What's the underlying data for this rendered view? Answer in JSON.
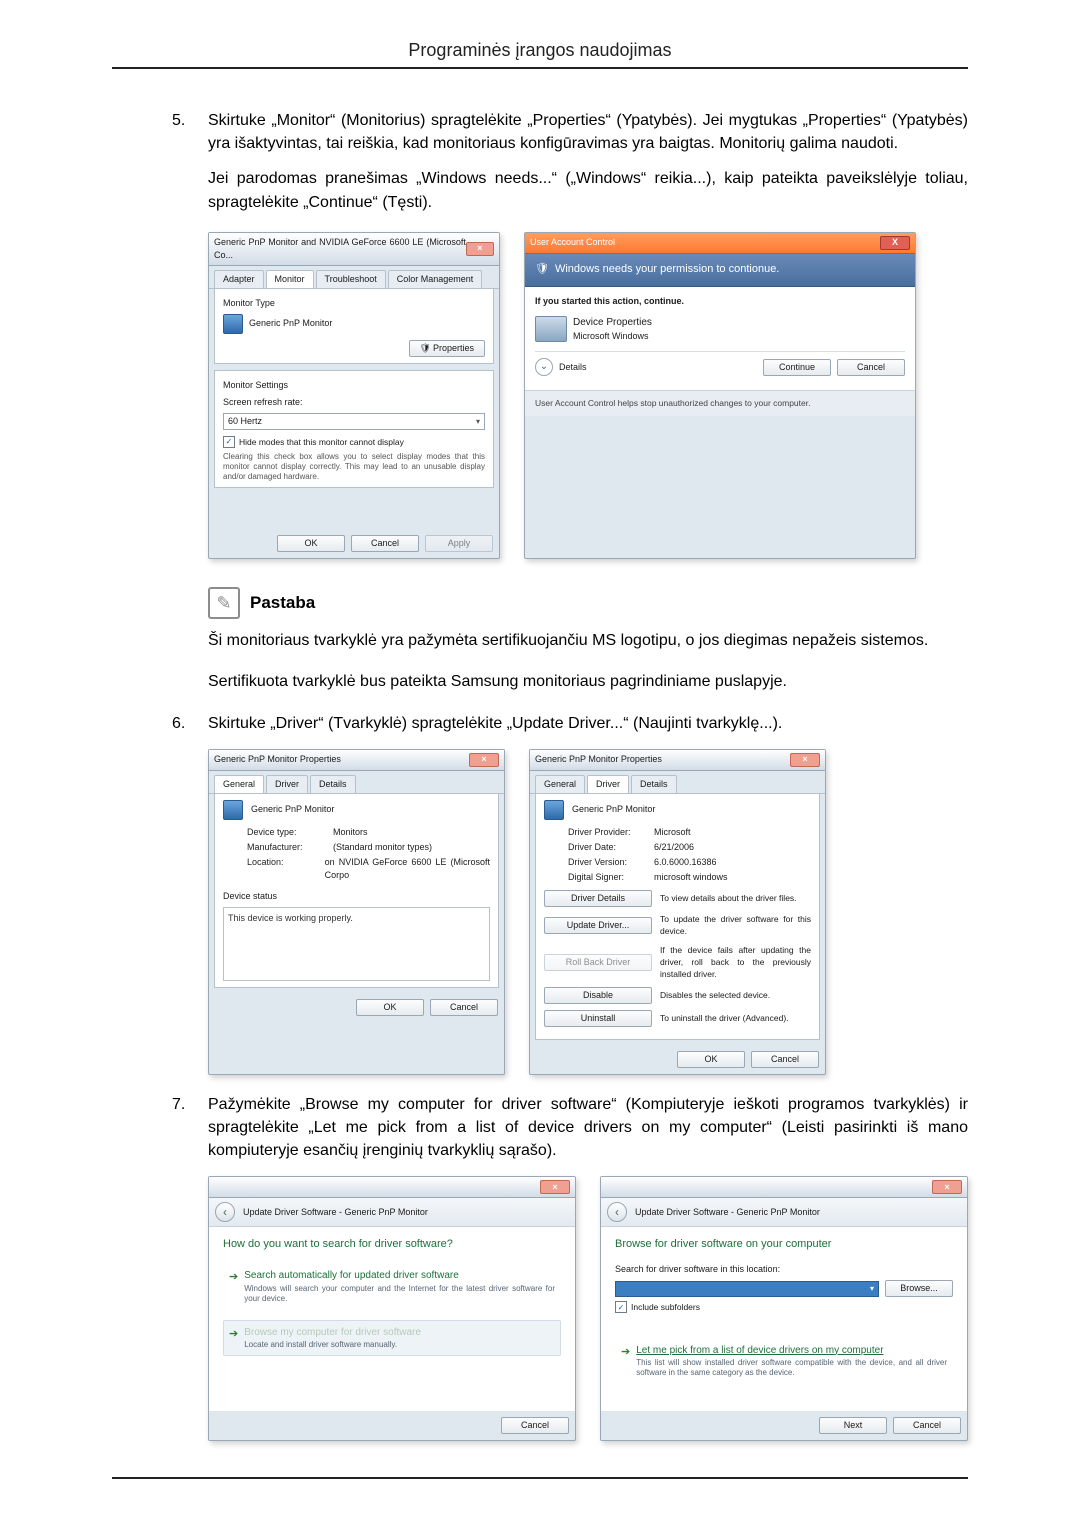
{
  "header": {
    "title": "Programinės įrangos naudojimas"
  },
  "step5": {
    "num": "5.",
    "text": "Skirtuke „Monitor“ (Monitorius) spragtelėkite „Properties“ (Ypatybės). Jei mygtukas „Properties“ (Ypatybės) yra išaktyvintas, tai reiškia, kad monitoriaus konfigūravimas yra baigtas. Monitorių galima naudoti.",
    "follow": "Jei parodomas pranešimas „Windows needs...“ („Windows“ reikia...), kaip pateikta paveikslėlyje toliau, spragtelėkite „Continue“ (Tęsti)."
  },
  "monWin": {
    "title": "Generic PnP Monitor and NVIDIA GeForce 6600 LE (Microsoft Co...",
    "tabs": {
      "adapter": "Adapter",
      "monitor": "Monitor",
      "troubleshoot": "Troubleshoot",
      "color": "Color Management"
    },
    "monitorType": "Monitor Type",
    "monitorName": "Generic PnP Monitor",
    "propertiesBtn": "Properties",
    "monitorSettings": "Monitor Settings",
    "refreshLabel": "Screen refresh rate:",
    "refreshValue": "60 Hertz",
    "hideModes": "Hide modes that this monitor cannot display",
    "hideModesDesc": "Clearing this check box allows you to select display modes that this monitor cannot display correctly. This may lead to an unusable display and/or damaged hardware.",
    "ok": "OK",
    "cancel": "Cancel",
    "apply": "Apply"
  },
  "uac": {
    "title": "User Account Control",
    "closeX": "X",
    "stripe": "Windows needs your permission to contionue.",
    "ifYou": "If you started this action, continue.",
    "devProps": "Device Properties",
    "msw": "Microsoft Windows",
    "details": "Details",
    "continue": "Continue",
    "cancel": "Cancel",
    "footer": "User Account Control helps stop unauthorized changes to your computer."
  },
  "pastaba": {
    "label": "Pastaba",
    "p1": "Ši monitoriaus tvarkyklė yra pažymėta sertifikuojančiu MS logotipu, o jos diegimas nepažeis sistemos.",
    "p2": "Sertifikuota tvarkyklė bus pateikta Samsung monitoriaus pagrindiniame puslapyje."
  },
  "step6": {
    "num": "6.",
    "text": "Skirtuke „Driver“ (Tvarkyklė) spragtelėkite „Update Driver...“ (Naujinti tvarkyklę...)."
  },
  "genProps": {
    "title": "Generic PnP Monitor Properties",
    "tabs": {
      "general": "General",
      "driver": "Driver",
      "details": "Details"
    },
    "name": "Generic PnP Monitor",
    "devType": {
      "k": "Device type:",
      "v": "Monitors"
    },
    "manuf": {
      "k": "Manufacturer:",
      "v": "(Standard monitor types)"
    },
    "loc": {
      "k": "Location:",
      "v": "on NVIDIA GeForce 6600 LE (Microsoft Corpo"
    },
    "devStatus": "Device status",
    "statusText": "This device is working properly.",
    "ok": "OK",
    "cancel": "Cancel"
  },
  "drvTab": {
    "title": "Generic PnP Monitor Properties",
    "name": "Generic PnP Monitor",
    "prov": {
      "k": "Driver Provider:",
      "v": "Microsoft"
    },
    "date": {
      "k": "Driver Date:",
      "v": "6/21/2006"
    },
    "ver": {
      "k": "Driver Version:",
      "v": "6.0.6000.16386"
    },
    "sign": {
      "k": "Digital Signer:",
      "v": "microsoft windows"
    },
    "details": {
      "btn": "Driver Details",
      "desc": "To view details about the driver files."
    },
    "update": {
      "btn": "Update Driver...",
      "desc": "To update the driver software for this device."
    },
    "rollback": {
      "btn": "Roll Back Driver",
      "desc": "If the device fails after updating the driver, roll back to the previously installed driver."
    },
    "disable": {
      "btn": "Disable",
      "desc": "Disables the selected device."
    },
    "uninstall": {
      "btn": "Uninstall",
      "desc": "To uninstall the driver (Advanced)."
    },
    "ok": "OK",
    "cancel": "Cancel"
  },
  "step7": {
    "num": "7.",
    "text": "Pažymėkite „Browse my computer for driver software“ (Kompiuteryje ieškoti programos tvarkyklės) ir spragtelėkite „Let me pick from a list of device drivers on my computer“ (Leisti pasirinkti iš mano kompiuteryje esančių įrenginių tvarkyklių sąrašo)."
  },
  "wiz1": {
    "crumb": "Update Driver Software - Generic PnP Monitor",
    "head": "How do you want to search for driver software?",
    "opt1t": "Search automatically for updated driver software",
    "opt1s": "Windows will search your computer and the Internet for the latest driver software for your device.",
    "opt2t": "Browse my computer for driver software",
    "opt2s": "Locate and install driver software manually.",
    "cancel": "Cancel"
  },
  "wiz2": {
    "crumb": "Update Driver Software - Generic PnP Monitor",
    "head": "Browse for driver software on your computer",
    "searchLbl": "Search for driver software in this location:",
    "browse": "Browse...",
    "includeSub": "Include subfolders",
    "pickT": "Let me pick from a list of device drivers on my computer",
    "pickS": "This list will show installed driver software compatible with the device, and all driver software in the same category as the device.",
    "next": "Next",
    "cancel": "Cancel"
  }
}
